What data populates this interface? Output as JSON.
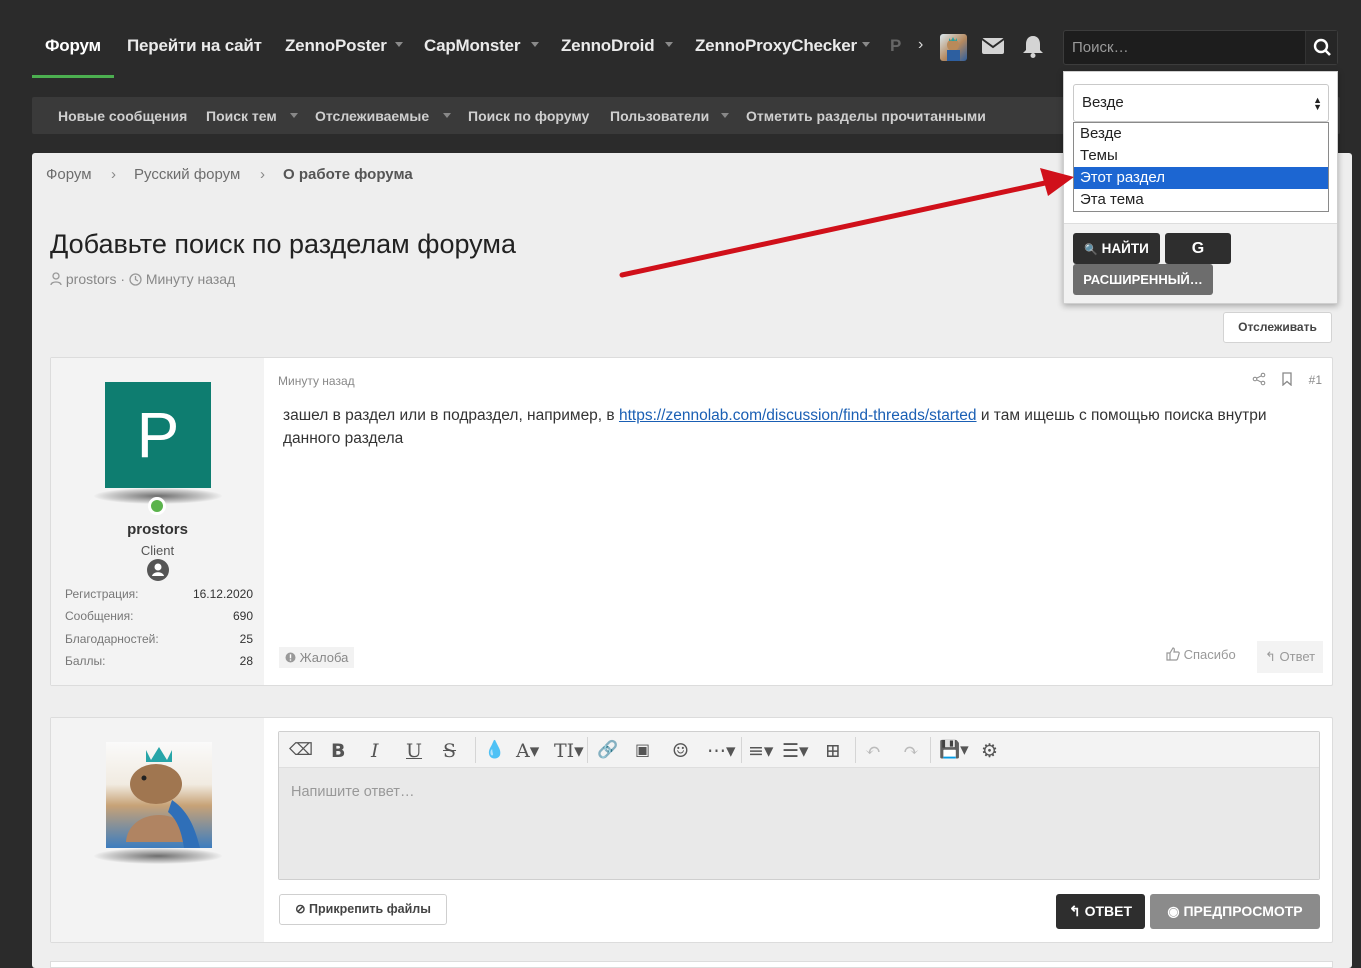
{
  "topnav": {
    "items": [
      {
        "label": "Форум"
      },
      {
        "label": "Перейти на сайт"
      },
      {
        "label": "ZennoPoster"
      },
      {
        "label": "CapMonster"
      },
      {
        "label": "ZennoDroid"
      },
      {
        "label": "ZennoProxyChecker"
      },
      {
        "label": "Р"
      }
    ],
    "more": "›",
    "search_placeholder": "Поиск…"
  },
  "subnav": {
    "items": [
      {
        "label": "Новые сообщения"
      },
      {
        "label": "Поиск тем"
      },
      {
        "label": "Отслеживаемые"
      },
      {
        "label": "Поиск по форуму"
      },
      {
        "label": "Пользователи"
      },
      {
        "label": "Отметить разделы прочитанными"
      }
    ]
  },
  "breadcrumb": {
    "items": [
      "Форум",
      "Русский форум"
    ],
    "current": "О работе форума",
    "sep": "›"
  },
  "thread": {
    "title": "Добавьте поиск по разделам форума",
    "author": "prostors",
    "time": "Минуту назад",
    "watch_label": "Отслеживать"
  },
  "post": {
    "avatar_letter": "P",
    "username": "prostors",
    "user_title": "Client",
    "stats": [
      {
        "label": "Регистрация:",
        "value": "16.12.2020"
      },
      {
        "label": "Сообщения:",
        "value": "690"
      },
      {
        "label": "Благодарностей:",
        "value": "25"
      },
      {
        "label": "Баллы:",
        "value": "28"
      }
    ],
    "time": "Минуту назад",
    "number": "#1",
    "body_before": "зашел в раздел или в подраздел, например, в ",
    "link": "https://zennolab.com/discussion/find-threads/started",
    "body_after": " и там ищешь с помощью поиска внутри данного раздела",
    "report": "Жалоба",
    "thanks": "Спасибо",
    "reply": "Ответ"
  },
  "reply_box": {
    "placeholder": "Напишите ответ…",
    "attach": "Прикрепить файлы",
    "answer": "ОТВЕТ",
    "preview": "ПРЕДПРОСМОТР"
  },
  "search_dropdown": {
    "selected": "Везде",
    "options": [
      "Везде",
      "Темы",
      "Этот раздел",
      "Эта тема"
    ],
    "highlighted": "Этот раздел",
    "find": "НАЙТИ",
    "google": "G",
    "advanced": "РАСШИРЕННЫЙ…"
  },
  "colors": {
    "accent_green": "#4caf50",
    "annotation_arrow": "#d0101a",
    "avatar_bg": "#0e7d70",
    "option_highlight": "#1c66d2"
  }
}
